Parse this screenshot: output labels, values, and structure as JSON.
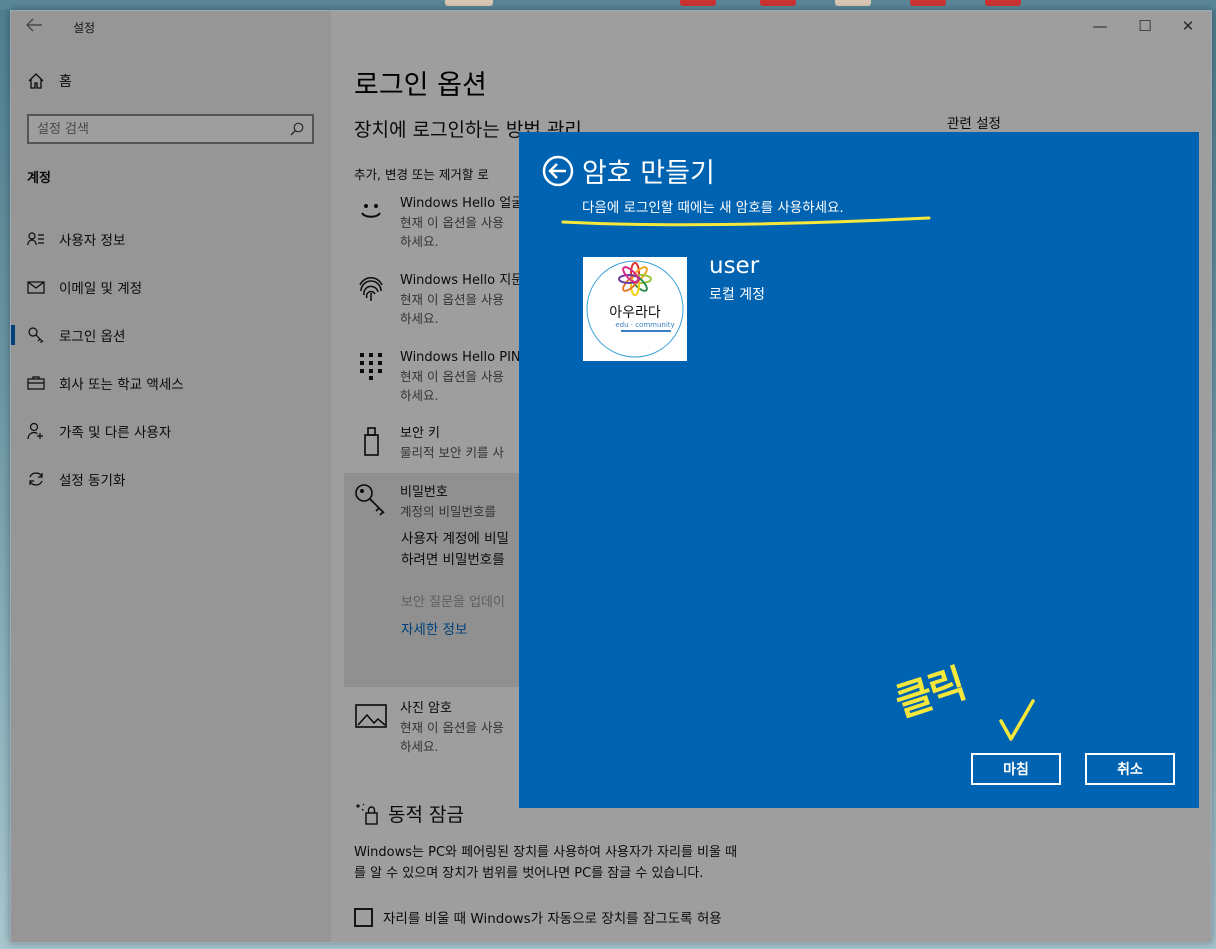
{
  "window": {
    "app_title": "설정",
    "back_icon": "back-arrow-icon",
    "controls": [
      "minimize-icon",
      "maximize-icon",
      "close-icon"
    ]
  },
  "sidebar": {
    "home_label": "홈",
    "search_placeholder": "설정 검색",
    "section_label": "계정",
    "items": [
      {
        "label": "사용자 정보",
        "icon": "user-info-icon"
      },
      {
        "label": "이메일 및 계정",
        "icon": "mail-icon"
      },
      {
        "label": "로그인 옵션",
        "icon": "key-icon",
        "active": true
      },
      {
        "label": "회사 또는 학교 액세스",
        "icon": "briefcase-icon"
      },
      {
        "label": "가족 및 다른 사용자",
        "icon": "person-add-icon"
      },
      {
        "label": "설정 동기화",
        "icon": "sync-icon"
      }
    ]
  },
  "main": {
    "title": "로그인 옵션",
    "subtitle": "장치에 로그인하는 방법 관리",
    "related_settings": "관련 설정",
    "intro": "추가, 변경 또는 제거할 로",
    "options": [
      {
        "title": "Windows Hello 얼굴",
        "desc1": "현재 이 옵션을 사용",
        "desc2": "하세요.",
        "icon": "face-icon"
      },
      {
        "title": "Windows Hello 지문",
        "desc1": "현재 이 옵션을 사용",
        "desc2": "하세요.",
        "icon": "fingerprint-icon"
      },
      {
        "title": "Windows Hello PIN",
        "desc1": "현재 이 옵션을 사용",
        "desc2": "하세요.",
        "icon": "keypad-icon"
      },
      {
        "title": "보안 키",
        "desc1": "물리적 보안 키를 사",
        "icon": "usb-key-icon"
      },
      {
        "title": "비밀번호",
        "desc1": "계정의 비밀번호를",
        "icon": "password-key-icon"
      },
      {
        "title": "사진 암호",
        "desc1": "현재 이 옵션을 사용",
        "desc2": "하세요.",
        "icon": "picture-icon"
      }
    ],
    "password_expanded": {
      "line1": "사용자 계정에 비밀",
      "line2": "하려면 비밀번호를",
      "muted": "보안 질문을 업데이",
      "link": "자세한 정보"
    },
    "dynamic_lock": {
      "title": "동적 잠금",
      "desc_line1": "Windows는 PC와 페어링된 장치를 사용하여 사용자가 자리를 비울 때",
      "desc_line2": "를 알 수 있으며 장치가 범위를 벗어나면 PC를 잠글 수 있습니다.",
      "checkbox_label": "자리를 비울 때 Windows가 자동으로 장치를 잠그도록 허용"
    }
  },
  "dialog": {
    "title": "암호 만들기",
    "subtitle": "다음에 로그인할 때에는 새 암호를 사용하세요.",
    "user_name": "user",
    "account_type": "로컬 계정",
    "avatar_text": "아우라다",
    "avatar_sub": "edu · community",
    "finish_button": "마침",
    "cancel_button": "취소",
    "bg_color": "#0063b1"
  },
  "annotation": {
    "text": "클릭"
  }
}
